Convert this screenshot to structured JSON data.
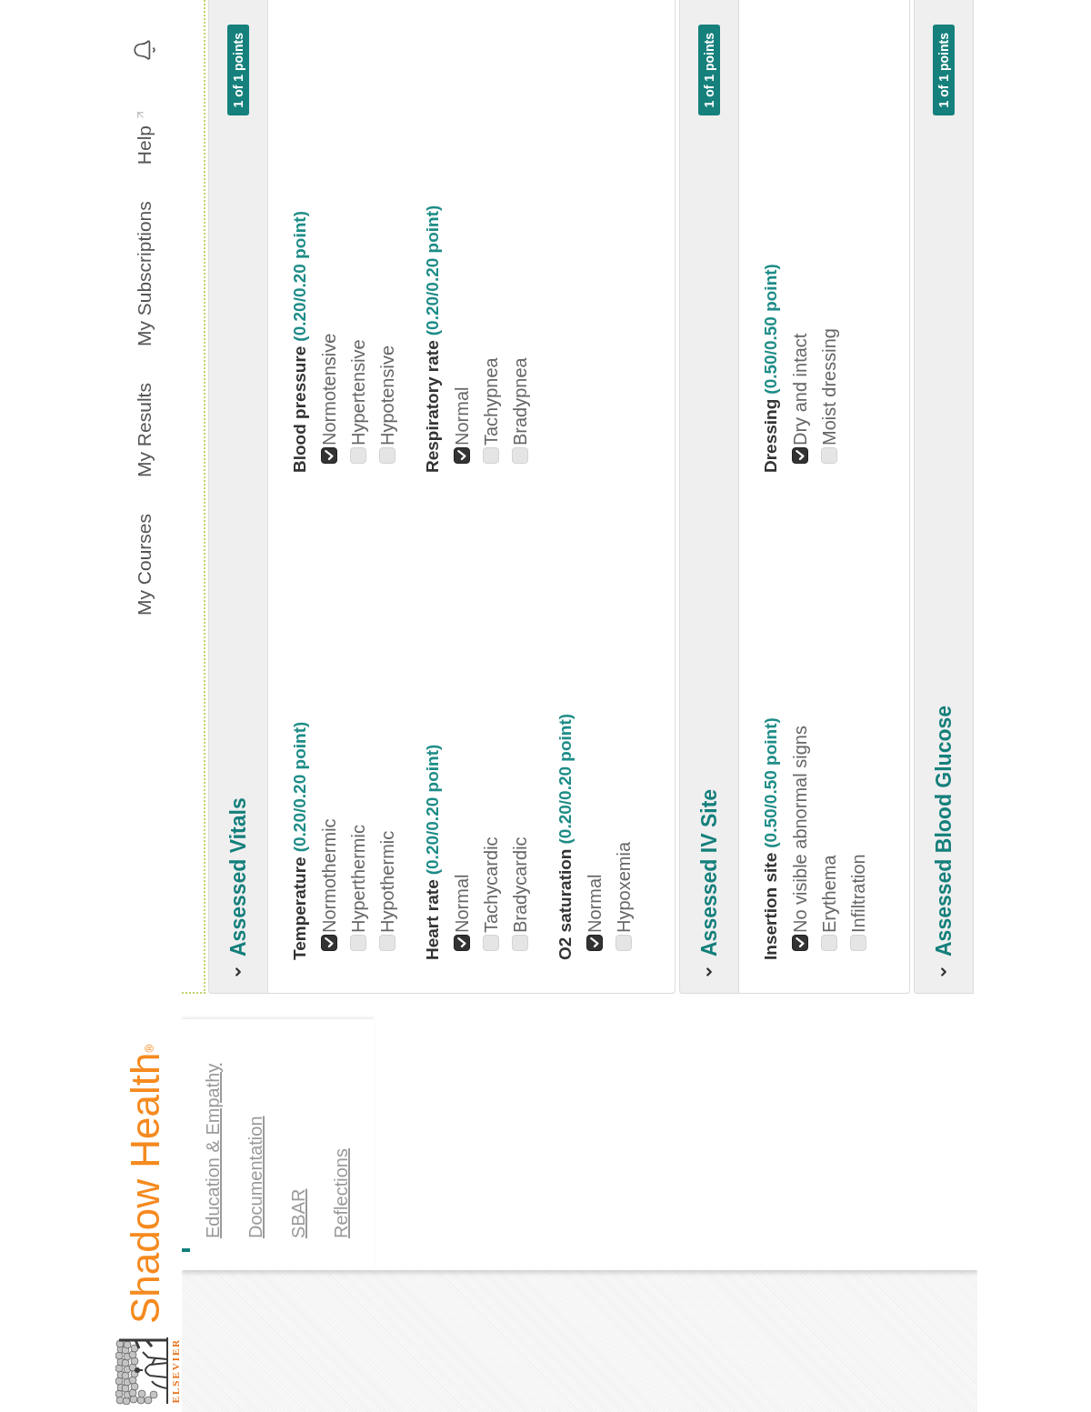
{
  "header": {
    "logo": {
      "wordmark": "ELSEVIER",
      "brand": "Shadow Health$^{®}$"
    },
    "nav": [
      {
        "label": "My Courses",
        "kind": "link"
      },
      {
        "label": "My Results",
        "kind": "link"
      },
      {
        "label": "My Subscriptions",
        "kind": "link"
      },
      {
        "label": "Help",
        "kind": "external"
      }
    ]
  },
  "sidebar": {
    "links": [
      {
        "label": "Education & Empathy"
      },
      {
        "label": "Documentation"
      },
      {
        "label": "SBAR"
      },
      {
        "label": "Reflections"
      }
    ]
  },
  "sections": [
    {
      "title": "Assessed Vitals",
      "score": "1 of 1 points",
      "expanded": true,
      "groups": [
        {
          "label": "Temperature",
          "score": "(0.20/0.20 point)",
          "options": [
            {
              "label": "Normothermic",
              "checked": true
            },
            {
              "label": "Hyperthermic",
              "checked": false
            },
            {
              "label": "Hypothermic",
              "checked": false
            }
          ]
        },
        {
          "label": "Blood pressure",
          "score": "(0.20/0.20 point)",
          "options": [
            {
              "label": "Normotensive",
              "checked": true
            },
            {
              "label": "Hypertensive",
              "checked": false
            },
            {
              "label": "Hypotensive",
              "checked": false
            }
          ]
        },
        {
          "label": "Heart rate",
          "score": "(0.20/0.20 point)",
          "options": [
            {
              "label": "Normal",
              "checked": true
            },
            {
              "label": "Tachycardic",
              "checked": false
            },
            {
              "label": "Bradycardic",
              "checked": false
            }
          ]
        },
        {
          "label": "Respiratory rate",
          "score": "(0.20/0.20 point)",
          "options": [
            {
              "label": "Normal",
              "checked": true
            },
            {
              "label": "Tachypnea",
              "checked": false
            },
            {
              "label": "Bradypnea",
              "checked": false
            }
          ]
        },
        {
          "label": "O2 saturation",
          "score": "(0.20/0.20 point)",
          "options": [
            {
              "label": "Normal",
              "checked": true
            },
            {
              "label": "Hypoxemia",
              "checked": false
            }
          ]
        }
      ]
    },
    {
      "title": "Assessed IV Site",
      "score": "1 of 1 points",
      "expanded": true,
      "groups": [
        {
          "label": "Insertion site",
          "score": "(0.50/0.50 point)",
          "options": [
            {
              "label": "No visible abnormal signs",
              "checked": true
            },
            {
              "label": "Erythema",
              "checked": false
            },
            {
              "label": "Infiltration",
              "checked": false
            }
          ]
        },
        {
          "label": "Dressing",
          "score": "(0.50/0.50 point)",
          "options": [
            {
              "label": "Dry and intact",
              "checked": true
            },
            {
              "label": "Moist dressing",
              "checked": false
            }
          ]
        }
      ]
    },
    {
      "title": "Assessed Blood Glucose",
      "score": "1 of 1 points",
      "expanded": true
    }
  ]
}
